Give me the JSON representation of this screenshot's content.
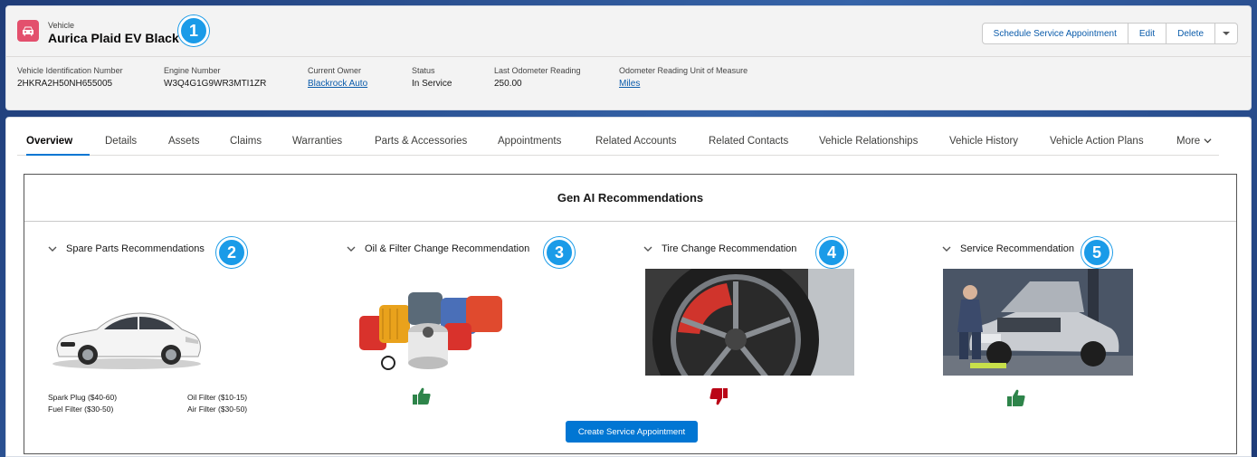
{
  "record": {
    "object_label": "Vehicle",
    "name": "Aurica Plaid EV Black"
  },
  "actions": {
    "schedule": "Schedule Service Appointment",
    "edit": "Edit",
    "delete": "Delete"
  },
  "fields": [
    {
      "label": "Vehicle Identification Number",
      "value": "2HKRA2H50NH655005",
      "link": false
    },
    {
      "label": "Engine Number",
      "value": "W3Q4G1G9WR3MTI1ZR",
      "link": false
    },
    {
      "label": "Current Owner",
      "value": "Blackrock Auto",
      "link": true
    },
    {
      "label": "Status",
      "value": "In Service",
      "link": false
    },
    {
      "label": "Last Odometer Reading",
      "value": "250.00",
      "link": false
    },
    {
      "label": "Odometer Reading Unit of Measure",
      "value": "Miles",
      "link": true
    }
  ],
  "tabs": [
    "Overview",
    "Details",
    "Assets",
    "Claims",
    "Warranties",
    "Parts & Accessories",
    "Appointments",
    "Related Accounts",
    "Related Contacts",
    "Vehicle Relationships",
    "Vehicle History",
    "Vehicle Action Plans",
    "More"
  ],
  "genai": {
    "title": "Gen AI Recommendations",
    "sections": [
      {
        "title": "Spare Parts Recommendations",
        "callout": "2"
      },
      {
        "title": "Oil & Filter Change Recommendation",
        "callout": "3",
        "feedback": "thumbs-up"
      },
      {
        "title": "Tire Change Recommendation",
        "callout": "4",
        "feedback": "thumbs-down"
      },
      {
        "title": "Service Recommendation",
        "callout": "5",
        "feedback": "thumbs-up"
      }
    ],
    "parts": [
      "Spark Plug ($40-60)",
      "Oil Filter ($10-15)",
      "Fuel Filter ($30-50)",
      "Air Filter ($30-50)"
    ],
    "create_button": "Create Service Appointment"
  },
  "callouts": {
    "header": "1"
  },
  "colors": {
    "brand": "#0176d3",
    "callout": "#1a9be8",
    "thumbs_up": "#2e844a",
    "thumbs_down": "#ba0517",
    "record_icon": "#e3506d"
  }
}
